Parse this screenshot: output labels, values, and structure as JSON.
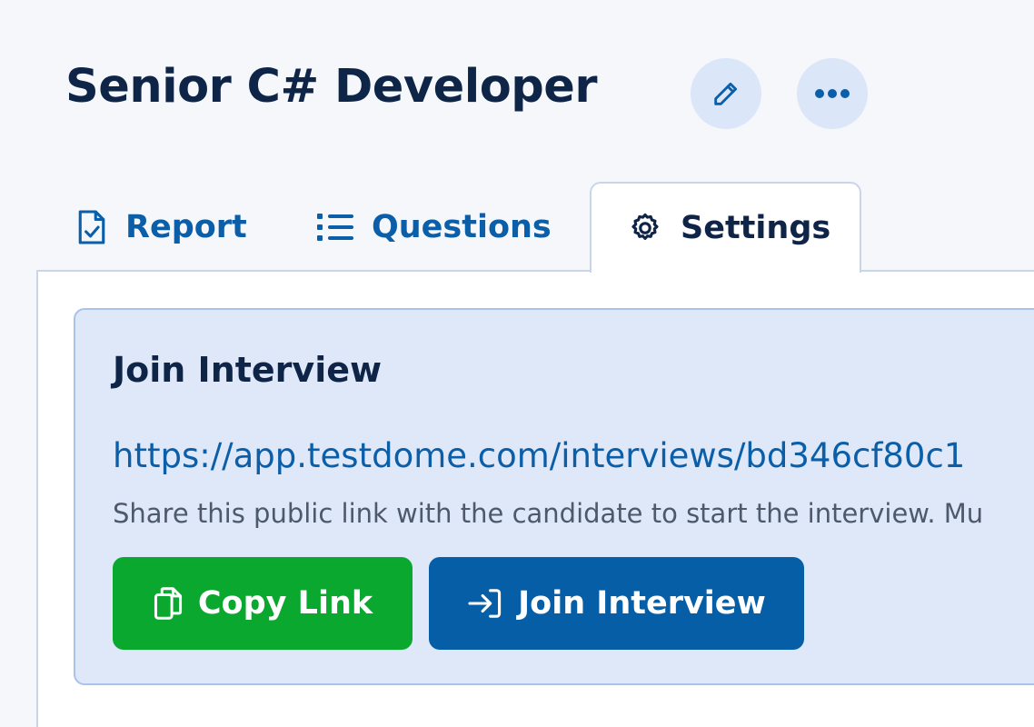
{
  "header": {
    "title": "Senior C# Developer",
    "edit_icon": "pencil-icon",
    "more_icon": "ellipsis-icon"
  },
  "tabs": [
    {
      "label": "Report",
      "icon": "report-check-icon",
      "active": false
    },
    {
      "label": "Questions",
      "icon": "list-icon",
      "active": false
    },
    {
      "label": "Settings",
      "icon": "gear-icon",
      "active": true
    }
  ],
  "join_interview": {
    "heading": "Join Interview",
    "link": "https://app.testdome.com/interviews/bd346cf80c1",
    "help_text": "Share this public link with the candidate to start the interview. Mu",
    "copy_button_label": "Copy Link",
    "join_button_label": "Join Interview"
  },
  "colors": {
    "background": "#f5f7fb",
    "title": "#0f2548",
    "accent_blue": "#0b5ea8",
    "round_button_bg": "#dbe6f9",
    "join_box_bg": "#dfe8f9",
    "copy_button": "#0aa82f",
    "join_button": "#065fa6"
  }
}
